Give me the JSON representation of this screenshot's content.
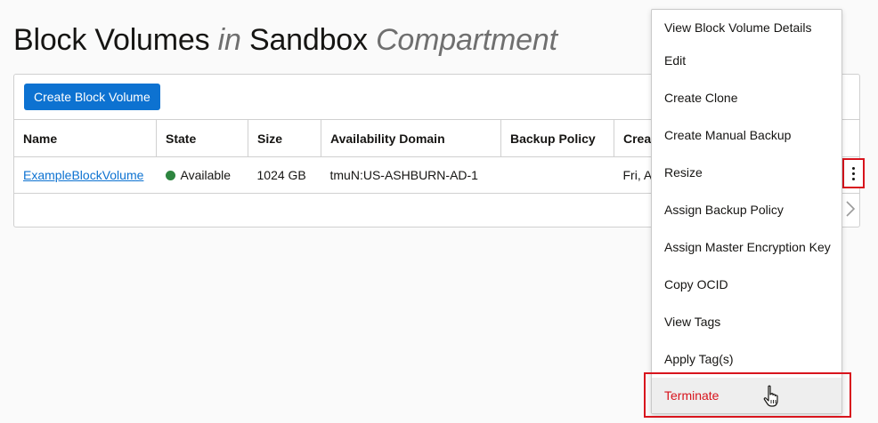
{
  "header": {
    "title_part1": "Block Volumes",
    "title_in": "in",
    "title_part2": "Sandbox",
    "title_part3": "Compartment"
  },
  "toolbar": {
    "create_label": "Create Block Volume"
  },
  "table": {
    "columns": [
      "Name",
      "State",
      "Size",
      "Availability Domain",
      "Backup Policy",
      "Crea"
    ],
    "rows": [
      {
        "name": "ExampleBlockVolume",
        "state": "Available",
        "size": "1024 GB",
        "availability_domain": "tmuN:US-ASHBURN-AD-1",
        "backup_policy": "",
        "created": "Fri, A"
      }
    ]
  },
  "menu": {
    "items": [
      "View Block Volume Details",
      "Edit",
      "Create Clone",
      "Create Manual Backup",
      "Resize",
      "Assign Backup Policy",
      "Assign Master Encryption Key",
      "Copy OCID",
      "View Tags",
      "Apply Tag(s)",
      "Terminate"
    ]
  },
  "colors": {
    "accent": "#0d72d1",
    "danger": "#d8141d",
    "status_available": "#2e8540"
  },
  "icons": {
    "row_actions": "kebab-icon",
    "pager": "chevron-right-icon",
    "status": "status-dot-icon",
    "pointer": "hand-cursor-icon"
  }
}
